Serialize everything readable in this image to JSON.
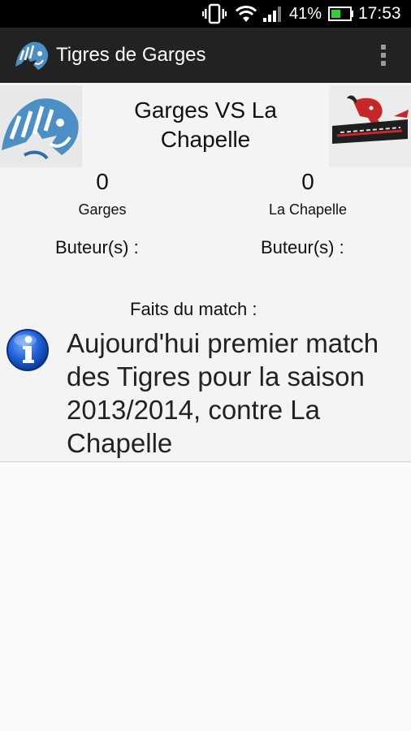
{
  "status_bar": {
    "battery_percent": "41%",
    "time": "17:53",
    "icons": [
      "vibrate-icon",
      "wifi-icon",
      "signal-icon",
      "battery-icon"
    ]
  },
  "action_bar": {
    "title": "Tigres de Garges",
    "logo_icon": "tiger-logo-icon",
    "menu_icon": "overflow-menu-icon"
  },
  "match": {
    "title": "Garges VS La Chapelle",
    "home": {
      "name": "Garges",
      "score": "0",
      "scorers_label": "Buteur(s) :",
      "logo": "tiger-logo"
    },
    "away": {
      "name": "La Chapelle",
      "score": "0",
      "scorers_label": "Buteur(s) :",
      "logo": "mustangs-logo"
    }
  },
  "facts": {
    "heading": "Faits du match :",
    "items": [
      {
        "icon": "info-icon",
        "text": "Aujourd'hui premier match des Tigres pour la saison 2013/2014, contre La Chapelle"
      }
    ]
  },
  "colors": {
    "status_bar_bg": "#000000",
    "action_bar_bg": "#222222",
    "content_bg": "#f4f4f4",
    "battery_fill": "#33cc33",
    "info_blue": "#1a4fbf"
  }
}
